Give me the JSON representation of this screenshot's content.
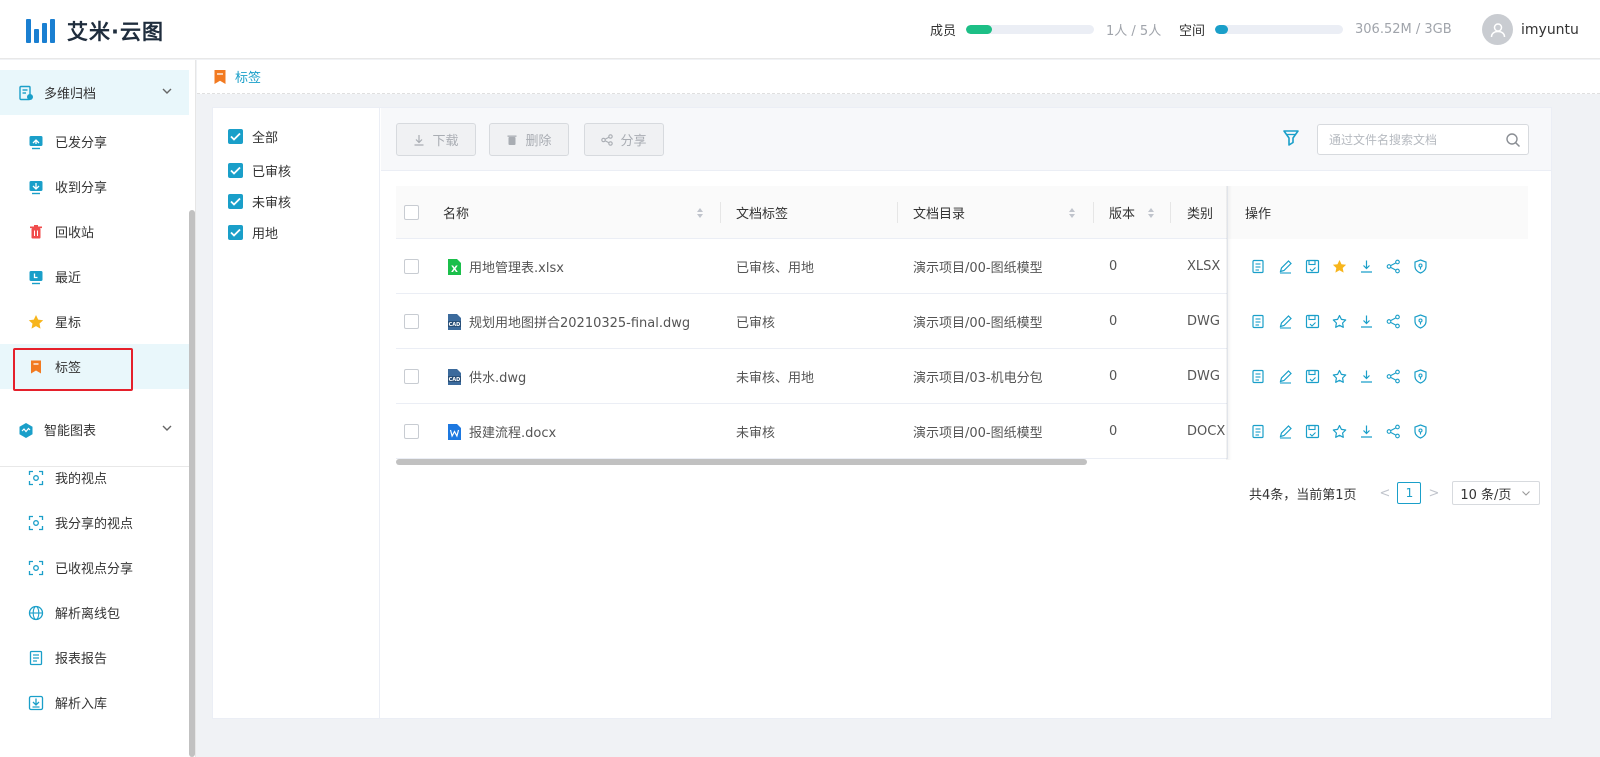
{
  "header": {
    "app_name": "艾米·云图",
    "members": {
      "label": "成员",
      "text": "1人 / 5人",
      "fraction": 0.2,
      "color": "#1dbf86"
    },
    "space": {
      "label": "空间",
      "text": "306.52M / 3GB",
      "fraction": 0.1,
      "color": "#1a9fc9"
    },
    "username": "imyuntu"
  },
  "sidebar": {
    "group1": {
      "label": "多维归档",
      "icon": "archive-icon"
    },
    "items1": [
      {
        "label": "已发分享",
        "icon": "sent-share-icon"
      },
      {
        "label": "收到分享",
        "icon": "received-share-icon"
      },
      {
        "label": "回收站",
        "icon": "trash-icon"
      },
      {
        "label": "最近",
        "icon": "recent-icon"
      },
      {
        "label": "星标",
        "icon": "star-icon"
      },
      {
        "label": "标签",
        "icon": "bookmark-icon"
      }
    ],
    "group2": {
      "label": "智能图表",
      "icon": "chart-icon"
    },
    "items2": [
      {
        "label": "我的视点",
        "icon": "viewpoint-icon"
      },
      {
        "label": "我分享的视点",
        "icon": "viewpoint-icon"
      },
      {
        "label": "已收视点分享",
        "icon": "viewpoint-icon"
      },
      {
        "label": "解析离线包",
        "icon": "globe-icon"
      },
      {
        "label": "报表报告",
        "icon": "report-icon"
      },
      {
        "label": "解析入库",
        "icon": "import-icon"
      }
    ]
  },
  "breadcrumb": {
    "label": "标签"
  },
  "filters": [
    {
      "label": "全部",
      "checked": true
    },
    {
      "label": "已审核",
      "checked": true
    },
    {
      "label": "未审核",
      "checked": true
    },
    {
      "label": "用地",
      "checked": true
    }
  ],
  "toolbar": {
    "download": "下载",
    "delete": "删除",
    "share": "分享",
    "search_placeholder": "通过文件名搜索文档"
  },
  "table": {
    "columns": {
      "name": "名称",
      "tags": "文档标签",
      "dir": "文档目录",
      "version": "版本",
      "type": "类别",
      "ops": "操作"
    },
    "rows": [
      {
        "name": "用地管理表.xlsx",
        "file_icon": "excel-file-icon",
        "tags": "已审核、用地",
        "dir": "演示项目/00-图纸模型",
        "version": "0",
        "type": "XLSX",
        "starred": true
      },
      {
        "name": "规划用地图拼合20210325-final.dwg",
        "file_icon": "cad-file-icon",
        "tags": "已审核",
        "dir": "演示项目/00-图纸模型",
        "version": "0",
        "type": "DWG",
        "starred": false
      },
      {
        "name": "供水.dwg",
        "file_icon": "cad-file-icon",
        "tags": "未审核、用地",
        "dir": "演示项目/03-机电分包",
        "version": "0",
        "type": "DWG",
        "starred": false
      },
      {
        "name": "报建流程.docx",
        "file_icon": "word-file-icon",
        "tags": "未审核",
        "dir": "演示项目/00-图纸模型",
        "version": "0",
        "type": "DOCX",
        "starred": false
      }
    ]
  },
  "pager": {
    "total": "共4条，当前第1页",
    "prev": "<",
    "page": "1",
    "next": ">",
    "size": "10 条/页"
  }
}
